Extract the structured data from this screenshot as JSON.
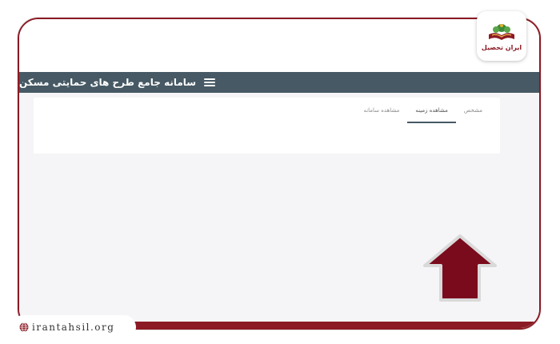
{
  "header": {
    "title": "سامانه جامع طرح های حمایتی مسکن",
    "menu_icon": "hamburger-menu-icon"
  },
  "tabs": [
    {
      "label": "مشخص"
    },
    {
      "label": "مشاهده زمینه"
    },
    {
      "label": "مشاهده سامانه"
    }
  ],
  "active_tab": 1,
  "branding": {
    "logo_name": "ایران تحصیل",
    "website": "irantahsil.org"
  },
  "colors": {
    "header": "#465964",
    "brand_red": "#8b1a24",
    "arrow": "#7a0b1c"
  }
}
